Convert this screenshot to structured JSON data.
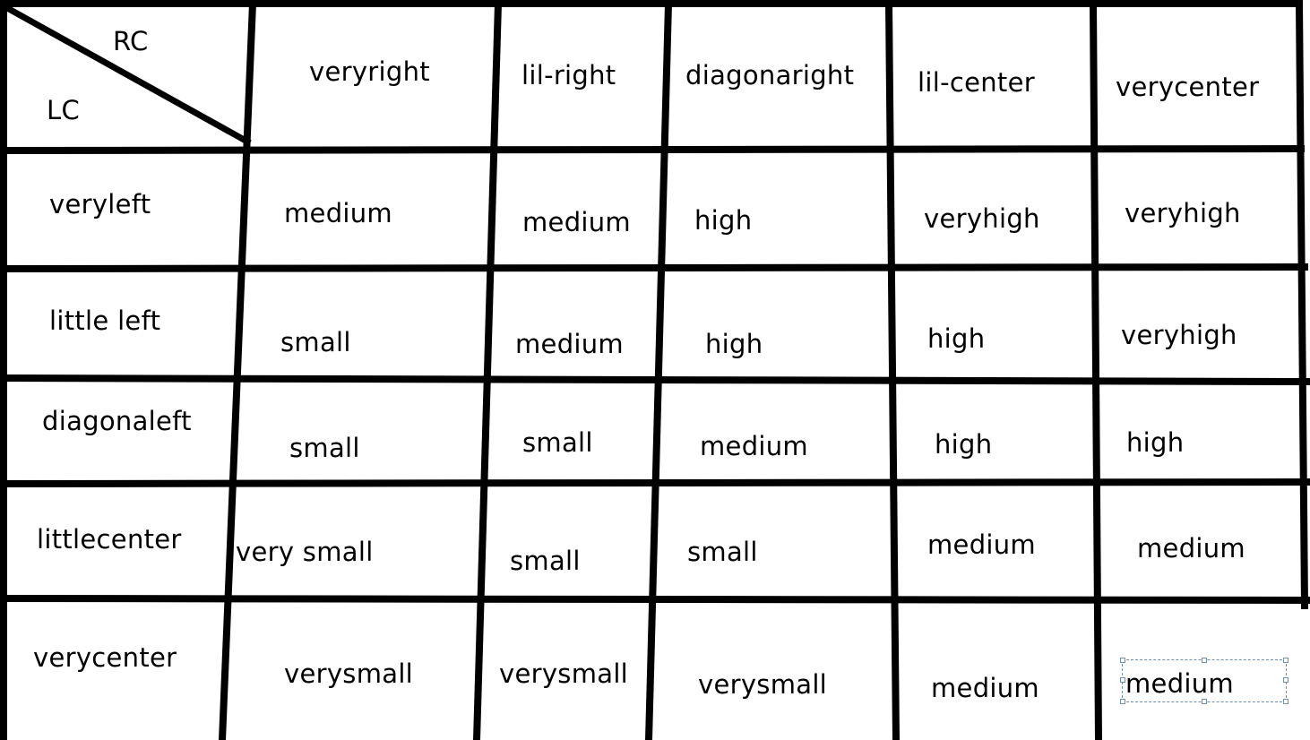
{
  "table": {
    "corner": {
      "top_right_label": "RC",
      "bottom_left_label": "LC"
    },
    "column_headers": [
      "veryright",
      "lil-right",
      "diagonaright",
      "lil-center",
      "verycenter"
    ],
    "rows": [
      {
        "label": "veryleft",
        "cells": [
          "medium",
          "medium",
          "high",
          "veryhigh",
          "veryhigh"
        ]
      },
      {
        "label": "little left",
        "cells": [
          "small",
          "medium",
          "high",
          "high",
          "veryhigh"
        ]
      },
      {
        "label": "diagonaleft",
        "cells": [
          "small",
          "small",
          "medium",
          "high",
          "high"
        ]
      },
      {
        "label": "littlecenter",
        "cells": [
          "very small",
          "small",
          "small",
          "medium",
          "medium"
        ]
      },
      {
        "label": "verycenter",
        "cells": [
          "verysmall",
          "verysmall",
          "verysmall",
          "medium",
          "medium"
        ]
      }
    ]
  }
}
